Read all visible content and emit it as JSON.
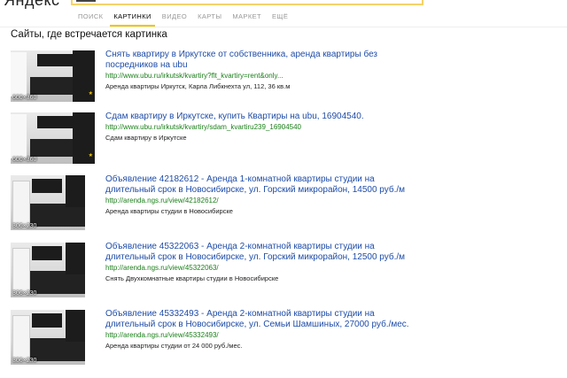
{
  "header": {
    "logo": "Яндекс",
    "search_text": "",
    "tabs": [
      {
        "label": "ПОИСК",
        "active": false
      },
      {
        "label": "КАРТИНКИ",
        "active": true
      },
      {
        "label": "ВИДЕО",
        "active": false
      },
      {
        "label": "КАРТЫ",
        "active": false
      },
      {
        "label": "МАРКЕТ",
        "active": false
      },
      {
        "label": "ЕЩЁ",
        "active": false
      }
    ]
  },
  "main": {
    "section_title": "Сайты, где встречается картинка",
    "results": [
      {
        "title": "Снять квартиру в Иркутске от собственника, аренда квартиры без посредников на ubu",
        "url": "http://www.ubu.ru/irkutsk/kvartiry?flt_kvartiry=rent&only...",
        "desc": "Аренда квартиры Иркутск, Карла Либкнехта ул, 112, 36 кв.м",
        "size": "600×360"
      },
      {
        "title": "Сдам квартиру в Иркутске, купить Квартиры на ubu, 16904540.",
        "url": "http://www.ubu.ru/irkutsk/kvartiry/sdam_kvartiru239_16904540",
        "desc": "Сдам квартиру в Иркутске",
        "size": "600×360"
      },
      {
        "title": "Объявление 42182612 - Аренда 1-комнатной квартиры студии на длительный срок в Новосибирске, ул. Горский микрорайон, 14500 руб./м",
        "url": "http://arenda.ngs.ru/view/42182612/",
        "desc": "Аренда квартиры студии в Новосибирске",
        "size": "306×230"
      },
      {
        "title": "Объявление 45322063 - Аренда 2-комнатной квартиры студии на длительный срок в Новосибирске, ул. Горский микрорайон, 12500 руб./м",
        "url": "http://arenda.ngs.ru/view/45322063/",
        "desc": "Снять Двухкомнатные квартиры студии в Новосибирске",
        "size": "306×230"
      },
      {
        "title": "Объявление 45332493 - Аренда 2-комнатной квартиры студии на длительный срок в Новосибирске, ул. Семьи Шамшиных, 27000 руб./мес.",
        "url": "http://arenda.ngs.ru/view/45332493/",
        "desc": "Аренда квартиры студии от 24 000 руб./мес.",
        "size": "306×230"
      }
    ]
  }
}
